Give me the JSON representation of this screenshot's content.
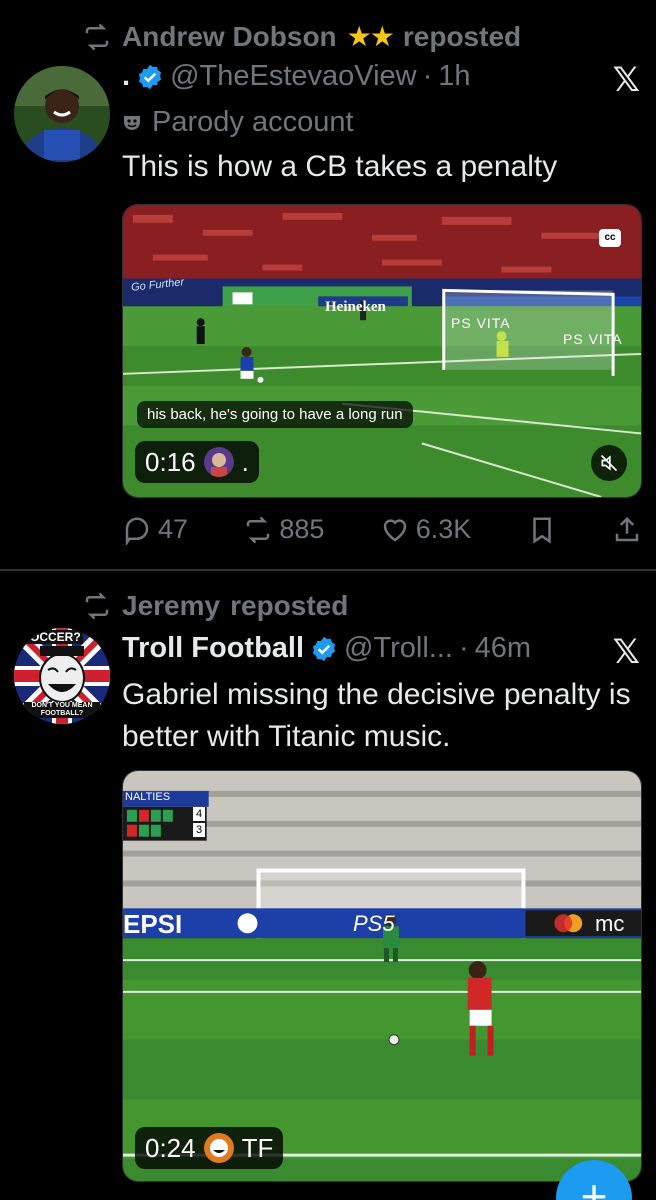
{
  "posts": [
    {
      "reposter": "Andrew Dobson",
      "reposter_suffix": "★★",
      "repost_label": "reposted",
      "author_name": ".",
      "handle": "@TheEstevaoView",
      "dot": "·",
      "time": "1h",
      "badge": "Parody account",
      "text": "This is how a CB takes a penalty",
      "video": {
        "caption": "his back, he's going to have a long run",
        "cc": "cc",
        "timestamp": "0:16",
        "timer_suffix": ".",
        "ad_texts": [
          "Go Further",
          "Heineken",
          "PS VITA",
          "PS VITA"
        ]
      },
      "stats": {
        "replies": "47",
        "reposts": "885",
        "likes": "6.3K"
      }
    },
    {
      "reposter": "Jeremy",
      "repost_label": "reposted",
      "author_name": "Troll Football",
      "handle": "@Troll...",
      "dot": "·",
      "time": "46m",
      "text": "Gabriel missing the decisive penalty is better with Titanic music.",
      "avatar_texts": [
        "SOCCER?",
        "DON'T YOU MEAN FOOTBALL?"
      ],
      "video": {
        "scoreboard_title": "NALTIES",
        "scoreboard_score1": "4",
        "scoreboard_score2": "3",
        "ad_texts": [
          "EPSI",
          "PS5",
          "mc"
        ],
        "timestamp": "0:24",
        "timer_suffix": "TF"
      }
    }
  ],
  "colors": {
    "accent": "#1d9bf0",
    "muted": "#71767b",
    "text": "#e7e9ea",
    "star": "#f5c518"
  },
  "fab_icon": "+"
}
